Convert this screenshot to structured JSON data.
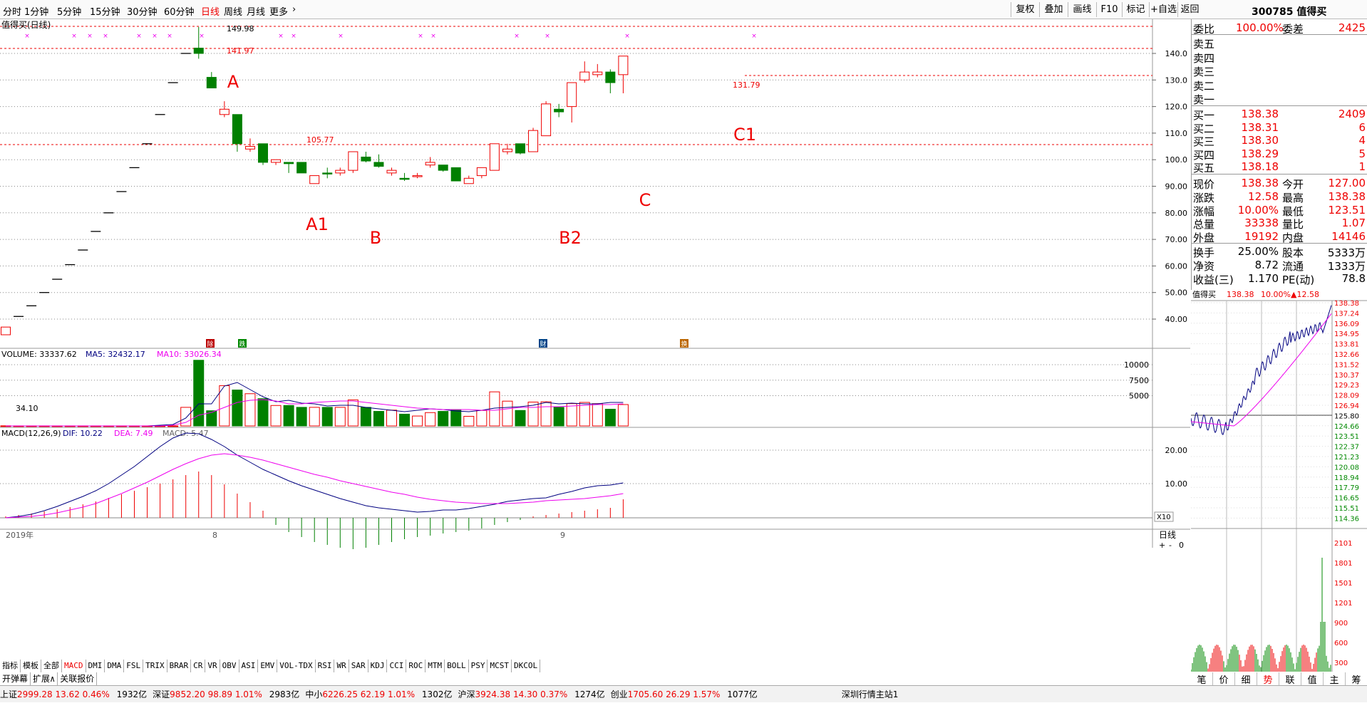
{
  "toolbar": {
    "periods": [
      "分时",
      "1分钟",
      "5分钟",
      "15分钟",
      "30分钟",
      "60分钟",
      "日线",
      "周线",
      "月线",
      "更多"
    ],
    "more_arrow": "›",
    "right_buttons": [
      "复权",
      "叠加",
      "画线",
      "F10",
      "标记",
      "+自选",
      "返回"
    ]
  },
  "header": {
    "title": "300785 值得买"
  },
  "chart": {
    "title": "值得买(日线)",
    "price_ticks": [
      "140.0",
      "130.0",
      "120.0",
      "110.0",
      "100.0",
      "90.00",
      "80.00",
      "70.00",
      "60.00",
      "50.00",
      "40.00"
    ],
    "annotations": [
      "A",
      "A1",
      "B",
      "B2",
      "C",
      "C1"
    ],
    "price_labels": [
      "149.98",
      "141.97",
      "105.77",
      "131.79",
      "34.10"
    ],
    "event_tags": [
      "除",
      "跌",
      "财",
      "换"
    ],
    "volume_legend": {
      "name": "VOLUME: 33337.62",
      "ma5": "MA5: 32432.17",
      "ma10": "MA10: 33026.34"
    },
    "volume_ticks": [
      "10000",
      "7500",
      "5000"
    ],
    "volume_unit": "X10",
    "macd_legend": {
      "name": "MACD(12,26,9)",
      "dif": "DIF: 10.22",
      "dea": "DEA: 7.49",
      "macd": "MACD: 5.47"
    },
    "macd_ticks": [
      "20.00",
      "10.00"
    ],
    "date_labels": [
      "2019年",
      "8",
      "9"
    ],
    "period_label": "日线",
    "zoom_controls": [
      "+",
      "-",
      "0"
    ]
  },
  "quote": {
    "weibi": {
      "label": "委比",
      "value": "100.00%",
      "label2": "委差",
      "value2": "2425"
    },
    "sells": [
      "卖五",
      "卖四",
      "卖三",
      "卖二",
      "卖一"
    ],
    "buys": [
      {
        "label": "买一",
        "price": "138.38",
        "vol": "2409"
      },
      {
        "label": "买二",
        "price": "138.31",
        "vol": "6"
      },
      {
        "label": "买三",
        "price": "138.30",
        "vol": "4"
      },
      {
        "label": "买四",
        "price": "138.29",
        "vol": "5"
      },
      {
        "label": "买五",
        "price": "138.18",
        "vol": "1"
      }
    ],
    "stats1": [
      {
        "l1": "现价",
        "v1": "138.38",
        "l2": "今开",
        "v2": "127.00"
      },
      {
        "l1": "涨跌",
        "v1": "12.58",
        "l2": "最高",
        "v2": "138.38"
      },
      {
        "l1": "涨幅",
        "v1": "10.00%",
        "l2": "最低",
        "v2": "123.51"
      },
      {
        "l1": "总量",
        "v1": "33338",
        "l2": "量比",
        "v2": "1.07"
      },
      {
        "l1": "外盘",
        "v1": "19192",
        "l2": "内盘",
        "v2": "14146"
      }
    ],
    "stats2": [
      {
        "l1": "换手",
        "v1": "25.00%",
        "l2": "股本",
        "v2": "5333万"
      },
      {
        "l1": "净资",
        "v1": "8.72",
        "l2": "流通",
        "v2": "1333万"
      },
      {
        "l1": "收益(三)",
        "v1": "1.170",
        "l2": "PE(动)",
        "v2": "78.8"
      }
    ]
  },
  "mini": {
    "header": {
      "name": "值得买",
      "price": "138.38",
      "pct": "10.00%",
      "chg": "▲12.58"
    },
    "price_ticks": [
      "138.38",
      "137.24",
      "136.09",
      "134.95",
      "133.81",
      "132.66",
      "131.52",
      "130.37",
      "129.23",
      "128.09",
      "126.94",
      "125.80",
      "124.66",
      "123.51",
      "122.37",
      "121.23",
      "120.08",
      "118.94",
      "117.79",
      "116.65",
      "115.51",
      "114.36"
    ],
    "vol_ticks": [
      "2101",
      "1801",
      "1501",
      "1201",
      "900",
      "600",
      "300"
    ],
    "tabs": [
      "笔",
      "价",
      "细",
      "势",
      "联",
      "值",
      "主",
      "筹"
    ]
  },
  "indicator_tabs": [
    "指标",
    "模板",
    "全部",
    "MACD",
    "DMI",
    "DMA",
    "FSL",
    "TRIX",
    "BRAR",
    "CR",
    "VR",
    "OBV",
    "ASI",
    "EMV",
    "VOL-TDX",
    "RSI",
    "WR",
    "SAR",
    "KDJ",
    "CCI",
    "ROC",
    "MTM",
    "BOLL",
    "PSY",
    "MCST",
    "DKCOL"
  ],
  "row2": [
    "开弹幕",
    "扩展∧",
    "关联报价"
  ],
  "status": {
    "indices": [
      {
        "name": "上证",
        "value": "2999.28",
        "chg": "13.62",
        "pct": "0.46%",
        "amt": "1932亿"
      },
      {
        "name": "深证",
        "value": "9852.20",
        "chg": "98.89",
        "pct": "1.01%",
        "amt": "2983亿"
      },
      {
        "name": "中小",
        "value": "6226.25",
        "chg": "62.19",
        "pct": "1.01%",
        "amt": "1302亿"
      },
      {
        "name": "沪深",
        "value": "3924.38",
        "chg": "14.30",
        "pct": "0.37%",
        "amt": "1274亿"
      },
      {
        "name": "创业",
        "value": "1705.60",
        "chg": "26.29",
        "pct": "1.57%",
        "amt": "1077亿"
      }
    ],
    "server": "深圳行情主站1"
  },
  "colors": {
    "up": "#e00",
    "down": "#008000",
    "ma5": "#000080",
    "ma10": "#e0e",
    "dash": "#e00"
  }
}
